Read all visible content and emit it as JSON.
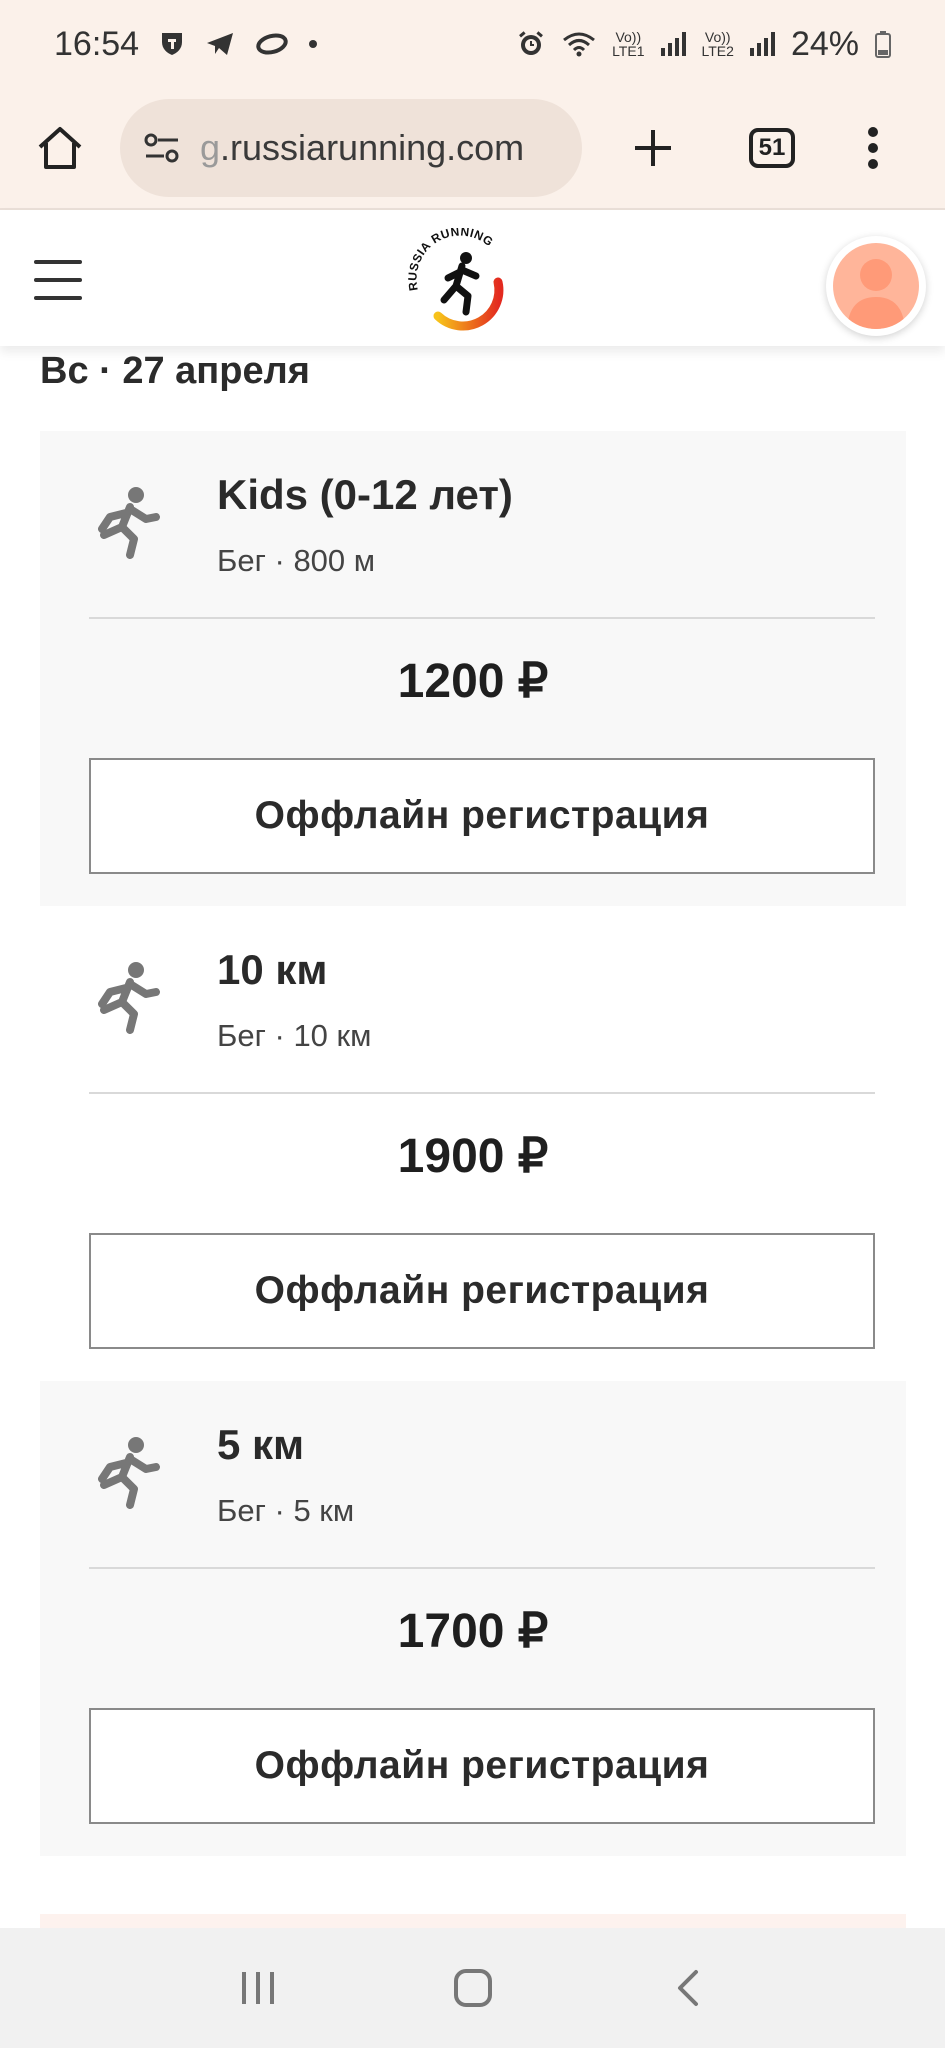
{
  "status_bar": {
    "time": "16:54",
    "volte1_top": "Vo))",
    "volte1_bottom": "LTE1",
    "volte2_top": "Vo))",
    "volte2_bottom": "LTE2",
    "battery": "24%"
  },
  "browser": {
    "url_faded": "g",
    "url_main": ".russiarunning.com",
    "tab_count": "51"
  },
  "site": {
    "logo_text": "RUSSIA RUNNING",
    "accent_color": "#e32a1f"
  },
  "content": {
    "date_heading": "Вс · 27 апреля",
    "cards": [
      {
        "title": "Kids (0-12 лет)",
        "subtitle": "Бег · 800 м",
        "price": "1200 ₽",
        "button": "Оффлайн регистрация"
      },
      {
        "title": "10 км",
        "subtitle": "Бег · 10 км",
        "price": "1900 ₽",
        "button": "Оффлайн регистрация"
      },
      {
        "title": "5 км",
        "subtitle": "Бег · 5 км",
        "price": "1700 ₽",
        "button": "Оффлайн регистрация"
      }
    ]
  }
}
